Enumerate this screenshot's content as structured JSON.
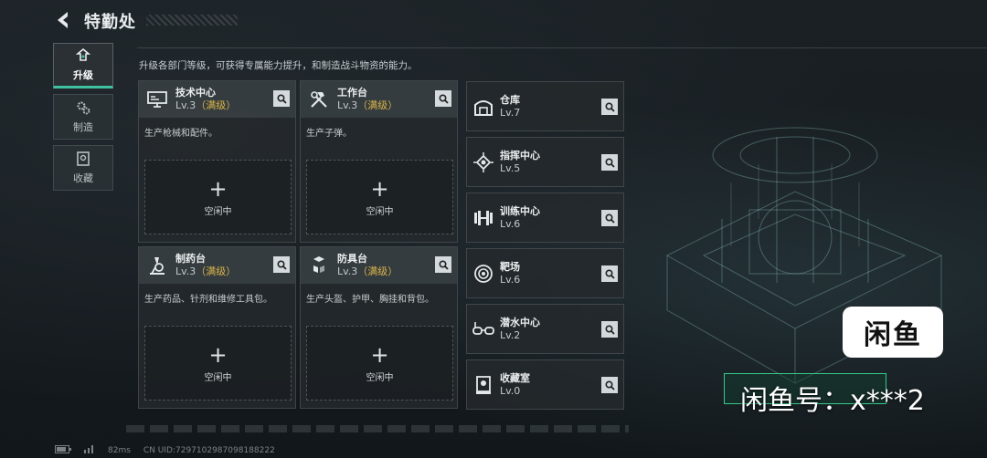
{
  "header": {
    "title": "特勤处"
  },
  "nav": [
    {
      "label": "升级",
      "icon": "upgrade-icon",
      "active": true
    },
    {
      "label": "制造",
      "icon": "gears-icon",
      "active": false
    },
    {
      "label": "收藏",
      "icon": "collection-icon",
      "active": false
    }
  ],
  "description": "升级各部门等级，可获得专属能力提升，和制造战斗物资的能力。",
  "cards": [
    {
      "name": "技术中心",
      "level": "Lv.3",
      "status": "（满级）",
      "desc": "生产枪械和配件。",
      "slot_label": "空闲中",
      "icon": "monitor-icon"
    },
    {
      "name": "工作台",
      "level": "Lv.3",
      "status": "（满级）",
      "desc": "生产子弹。",
      "slot_label": "空闲中",
      "icon": "hammer-wrench-icon"
    },
    {
      "name": "制药台",
      "level": "Lv.3",
      "status": "（满级）",
      "desc": "生产药品、针剂和维修工具包。",
      "slot_label": "空闲中",
      "icon": "microscope-icon"
    },
    {
      "name": "防具台",
      "level": "Lv.3",
      "status": "（满级）",
      "desc": "生产头盔、护甲、胸挂和背包。",
      "slot_label": "空闲中",
      "icon": "cubes-icon"
    }
  ],
  "facilities": [
    {
      "name": "仓库",
      "level": "Lv.7",
      "icon": "warehouse-icon"
    },
    {
      "name": "指挥中心",
      "level": "Lv.5",
      "icon": "chip-icon"
    },
    {
      "name": "训练中心",
      "level": "Lv.6",
      "icon": "dumbbell-icon"
    },
    {
      "name": "靶场",
      "level": "Lv.6",
      "icon": "target-icon"
    },
    {
      "name": "潜水中心",
      "level": "Lv.2",
      "icon": "goggles-icon"
    },
    {
      "name": "收藏室",
      "level": "Lv.0",
      "icon": "display-case-icon"
    }
  ],
  "plus_symbol": "+",
  "status": {
    "ping": "82ms",
    "uid": "CN UID:7297102987098188222"
  },
  "watermark": {
    "logo": "闲鱼",
    "text": "闲鱼号：x***2"
  },
  "colors": {
    "accent": "#3fc0a0",
    "maxed": "#d9b44a"
  }
}
